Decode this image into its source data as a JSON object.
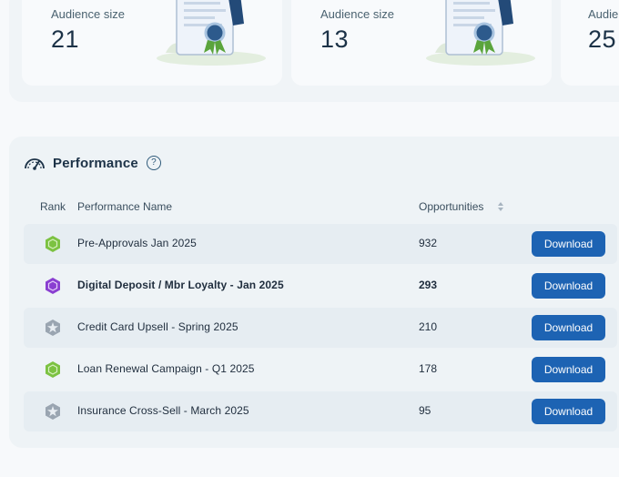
{
  "audience_cards": [
    {
      "label": "Audience size",
      "value": "21"
    },
    {
      "label": "Audience size",
      "value": "13"
    },
    {
      "label": "Audien",
      "value": "25"
    }
  ],
  "performance": {
    "title": "Performance",
    "help_icon": "question-circle-icon",
    "header_icon": "speedometer-icon",
    "columns": {
      "rank": "Rank",
      "name": "Performance Name",
      "opportunities": "Opportunities"
    },
    "rows": [
      {
        "rank_badge": "green-hexagon-badge",
        "name": "Pre-Approvals Jan 2025",
        "opportunities": "932",
        "action": "Download"
      },
      {
        "rank_badge": "purple-hexagon-badge",
        "name": "Digital Deposit / Mbr Loyalty - Jan 2025",
        "opportunities": "293",
        "action": "Download"
      },
      {
        "rank_badge": "gray-star-hexagon-badge",
        "name": "Credit Card Upsell - Spring 2025",
        "opportunities": "210",
        "action": "Download"
      },
      {
        "rank_badge": "green-hexagon-badge",
        "name": "Loan Renewal Campaign - Q1 2025",
        "opportunities": "178",
        "action": "Download"
      },
      {
        "rank_badge": "gray-star-hexagon-badge",
        "name": "Insurance Cross-Sell - March 2025",
        "opportunities": "95",
        "action": "Download"
      }
    ]
  },
  "colors": {
    "accent": "#1d63b3",
    "badge_green": "#7cc242",
    "badge_purple": "#8a3fd1",
    "badge_gray": "#9aa5b1"
  }
}
